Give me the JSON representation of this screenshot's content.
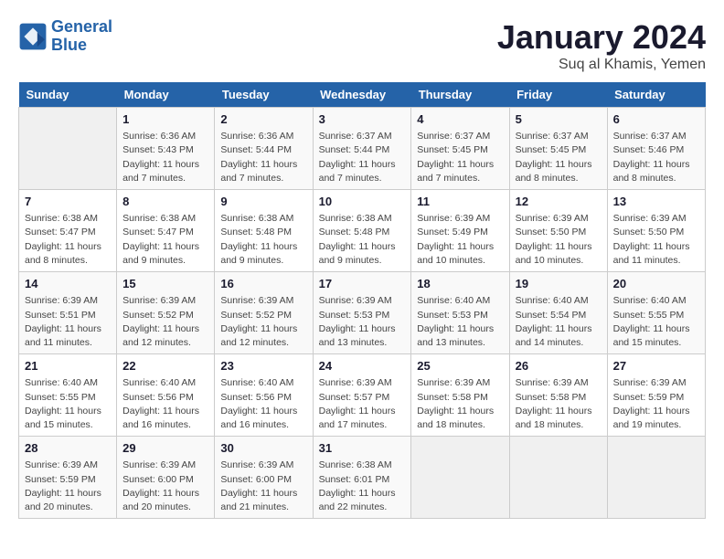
{
  "header": {
    "logo_line1": "General",
    "logo_line2": "Blue",
    "month": "January 2024",
    "location": "Suq al Khamis, Yemen"
  },
  "weekdays": [
    "Sunday",
    "Monday",
    "Tuesday",
    "Wednesday",
    "Thursday",
    "Friday",
    "Saturday"
  ],
  "weeks": [
    [
      {
        "day": "",
        "info": ""
      },
      {
        "day": "1",
        "info": "Sunrise: 6:36 AM\nSunset: 5:43 PM\nDaylight: 11 hours and 7 minutes."
      },
      {
        "day": "2",
        "info": "Sunrise: 6:36 AM\nSunset: 5:44 PM\nDaylight: 11 hours and 7 minutes."
      },
      {
        "day": "3",
        "info": "Sunrise: 6:37 AM\nSunset: 5:44 PM\nDaylight: 11 hours and 7 minutes."
      },
      {
        "day": "4",
        "info": "Sunrise: 6:37 AM\nSunset: 5:45 PM\nDaylight: 11 hours and 7 minutes."
      },
      {
        "day": "5",
        "info": "Sunrise: 6:37 AM\nSunset: 5:45 PM\nDaylight: 11 hours and 8 minutes."
      },
      {
        "day": "6",
        "info": "Sunrise: 6:37 AM\nSunset: 5:46 PM\nDaylight: 11 hours and 8 minutes."
      }
    ],
    [
      {
        "day": "7",
        "info": "Sunrise: 6:38 AM\nSunset: 5:47 PM\nDaylight: 11 hours and 8 minutes."
      },
      {
        "day": "8",
        "info": "Sunrise: 6:38 AM\nSunset: 5:47 PM\nDaylight: 11 hours and 9 minutes."
      },
      {
        "day": "9",
        "info": "Sunrise: 6:38 AM\nSunset: 5:48 PM\nDaylight: 11 hours and 9 minutes."
      },
      {
        "day": "10",
        "info": "Sunrise: 6:38 AM\nSunset: 5:48 PM\nDaylight: 11 hours and 9 minutes."
      },
      {
        "day": "11",
        "info": "Sunrise: 6:39 AM\nSunset: 5:49 PM\nDaylight: 11 hours and 10 minutes."
      },
      {
        "day": "12",
        "info": "Sunrise: 6:39 AM\nSunset: 5:50 PM\nDaylight: 11 hours and 10 minutes."
      },
      {
        "day": "13",
        "info": "Sunrise: 6:39 AM\nSunset: 5:50 PM\nDaylight: 11 hours and 11 minutes."
      }
    ],
    [
      {
        "day": "14",
        "info": "Sunrise: 6:39 AM\nSunset: 5:51 PM\nDaylight: 11 hours and 11 minutes."
      },
      {
        "day": "15",
        "info": "Sunrise: 6:39 AM\nSunset: 5:52 PM\nDaylight: 11 hours and 12 minutes."
      },
      {
        "day": "16",
        "info": "Sunrise: 6:39 AM\nSunset: 5:52 PM\nDaylight: 11 hours and 12 minutes."
      },
      {
        "day": "17",
        "info": "Sunrise: 6:39 AM\nSunset: 5:53 PM\nDaylight: 11 hours and 13 minutes."
      },
      {
        "day": "18",
        "info": "Sunrise: 6:40 AM\nSunset: 5:53 PM\nDaylight: 11 hours and 13 minutes."
      },
      {
        "day": "19",
        "info": "Sunrise: 6:40 AM\nSunset: 5:54 PM\nDaylight: 11 hours and 14 minutes."
      },
      {
        "day": "20",
        "info": "Sunrise: 6:40 AM\nSunset: 5:55 PM\nDaylight: 11 hours and 15 minutes."
      }
    ],
    [
      {
        "day": "21",
        "info": "Sunrise: 6:40 AM\nSunset: 5:55 PM\nDaylight: 11 hours and 15 minutes."
      },
      {
        "day": "22",
        "info": "Sunrise: 6:40 AM\nSunset: 5:56 PM\nDaylight: 11 hours and 16 minutes."
      },
      {
        "day": "23",
        "info": "Sunrise: 6:40 AM\nSunset: 5:56 PM\nDaylight: 11 hours and 16 minutes."
      },
      {
        "day": "24",
        "info": "Sunrise: 6:39 AM\nSunset: 5:57 PM\nDaylight: 11 hours and 17 minutes."
      },
      {
        "day": "25",
        "info": "Sunrise: 6:39 AM\nSunset: 5:58 PM\nDaylight: 11 hours and 18 minutes."
      },
      {
        "day": "26",
        "info": "Sunrise: 6:39 AM\nSunset: 5:58 PM\nDaylight: 11 hours and 18 minutes."
      },
      {
        "day": "27",
        "info": "Sunrise: 6:39 AM\nSunset: 5:59 PM\nDaylight: 11 hours and 19 minutes."
      }
    ],
    [
      {
        "day": "28",
        "info": "Sunrise: 6:39 AM\nSunset: 5:59 PM\nDaylight: 11 hours and 20 minutes."
      },
      {
        "day": "29",
        "info": "Sunrise: 6:39 AM\nSunset: 6:00 PM\nDaylight: 11 hours and 20 minutes."
      },
      {
        "day": "30",
        "info": "Sunrise: 6:39 AM\nSunset: 6:00 PM\nDaylight: 11 hours and 21 minutes."
      },
      {
        "day": "31",
        "info": "Sunrise: 6:38 AM\nSunset: 6:01 PM\nDaylight: 11 hours and 22 minutes."
      },
      {
        "day": "",
        "info": ""
      },
      {
        "day": "",
        "info": ""
      },
      {
        "day": "",
        "info": ""
      }
    ]
  ]
}
